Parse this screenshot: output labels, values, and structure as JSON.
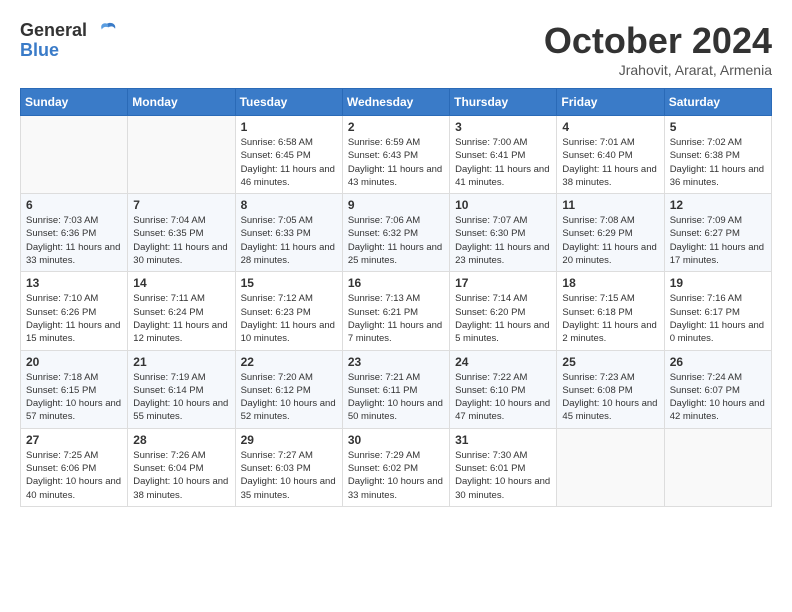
{
  "logo": {
    "line1": "General",
    "line2": "Blue"
  },
  "title": "October 2024",
  "location": "Jrahovit, Ararat, Armenia",
  "weekdays": [
    "Sunday",
    "Monday",
    "Tuesday",
    "Wednesday",
    "Thursday",
    "Friday",
    "Saturday"
  ],
  "weeks": [
    [
      {
        "day": "",
        "info": ""
      },
      {
        "day": "",
        "info": ""
      },
      {
        "day": "1",
        "info": "Sunrise: 6:58 AM\nSunset: 6:45 PM\nDaylight: 11 hours and 46 minutes."
      },
      {
        "day": "2",
        "info": "Sunrise: 6:59 AM\nSunset: 6:43 PM\nDaylight: 11 hours and 43 minutes."
      },
      {
        "day": "3",
        "info": "Sunrise: 7:00 AM\nSunset: 6:41 PM\nDaylight: 11 hours and 41 minutes."
      },
      {
        "day": "4",
        "info": "Sunrise: 7:01 AM\nSunset: 6:40 PM\nDaylight: 11 hours and 38 minutes."
      },
      {
        "day": "5",
        "info": "Sunrise: 7:02 AM\nSunset: 6:38 PM\nDaylight: 11 hours and 36 minutes."
      }
    ],
    [
      {
        "day": "6",
        "info": "Sunrise: 7:03 AM\nSunset: 6:36 PM\nDaylight: 11 hours and 33 minutes."
      },
      {
        "day": "7",
        "info": "Sunrise: 7:04 AM\nSunset: 6:35 PM\nDaylight: 11 hours and 30 minutes."
      },
      {
        "day": "8",
        "info": "Sunrise: 7:05 AM\nSunset: 6:33 PM\nDaylight: 11 hours and 28 minutes."
      },
      {
        "day": "9",
        "info": "Sunrise: 7:06 AM\nSunset: 6:32 PM\nDaylight: 11 hours and 25 minutes."
      },
      {
        "day": "10",
        "info": "Sunrise: 7:07 AM\nSunset: 6:30 PM\nDaylight: 11 hours and 23 minutes."
      },
      {
        "day": "11",
        "info": "Sunrise: 7:08 AM\nSunset: 6:29 PM\nDaylight: 11 hours and 20 minutes."
      },
      {
        "day": "12",
        "info": "Sunrise: 7:09 AM\nSunset: 6:27 PM\nDaylight: 11 hours and 17 minutes."
      }
    ],
    [
      {
        "day": "13",
        "info": "Sunrise: 7:10 AM\nSunset: 6:26 PM\nDaylight: 11 hours and 15 minutes."
      },
      {
        "day": "14",
        "info": "Sunrise: 7:11 AM\nSunset: 6:24 PM\nDaylight: 11 hours and 12 minutes."
      },
      {
        "day": "15",
        "info": "Sunrise: 7:12 AM\nSunset: 6:23 PM\nDaylight: 11 hours and 10 minutes."
      },
      {
        "day": "16",
        "info": "Sunrise: 7:13 AM\nSunset: 6:21 PM\nDaylight: 11 hours and 7 minutes."
      },
      {
        "day": "17",
        "info": "Sunrise: 7:14 AM\nSunset: 6:20 PM\nDaylight: 11 hours and 5 minutes."
      },
      {
        "day": "18",
        "info": "Sunrise: 7:15 AM\nSunset: 6:18 PM\nDaylight: 11 hours and 2 minutes."
      },
      {
        "day": "19",
        "info": "Sunrise: 7:16 AM\nSunset: 6:17 PM\nDaylight: 11 hours and 0 minutes."
      }
    ],
    [
      {
        "day": "20",
        "info": "Sunrise: 7:18 AM\nSunset: 6:15 PM\nDaylight: 10 hours and 57 minutes."
      },
      {
        "day": "21",
        "info": "Sunrise: 7:19 AM\nSunset: 6:14 PM\nDaylight: 10 hours and 55 minutes."
      },
      {
        "day": "22",
        "info": "Sunrise: 7:20 AM\nSunset: 6:12 PM\nDaylight: 10 hours and 52 minutes."
      },
      {
        "day": "23",
        "info": "Sunrise: 7:21 AM\nSunset: 6:11 PM\nDaylight: 10 hours and 50 minutes."
      },
      {
        "day": "24",
        "info": "Sunrise: 7:22 AM\nSunset: 6:10 PM\nDaylight: 10 hours and 47 minutes."
      },
      {
        "day": "25",
        "info": "Sunrise: 7:23 AM\nSunset: 6:08 PM\nDaylight: 10 hours and 45 minutes."
      },
      {
        "day": "26",
        "info": "Sunrise: 7:24 AM\nSunset: 6:07 PM\nDaylight: 10 hours and 42 minutes."
      }
    ],
    [
      {
        "day": "27",
        "info": "Sunrise: 7:25 AM\nSunset: 6:06 PM\nDaylight: 10 hours and 40 minutes."
      },
      {
        "day": "28",
        "info": "Sunrise: 7:26 AM\nSunset: 6:04 PM\nDaylight: 10 hours and 38 minutes."
      },
      {
        "day": "29",
        "info": "Sunrise: 7:27 AM\nSunset: 6:03 PM\nDaylight: 10 hours and 35 minutes."
      },
      {
        "day": "30",
        "info": "Sunrise: 7:29 AM\nSunset: 6:02 PM\nDaylight: 10 hours and 33 minutes."
      },
      {
        "day": "31",
        "info": "Sunrise: 7:30 AM\nSunset: 6:01 PM\nDaylight: 10 hours and 30 minutes."
      },
      {
        "day": "",
        "info": ""
      },
      {
        "day": "",
        "info": ""
      }
    ]
  ]
}
